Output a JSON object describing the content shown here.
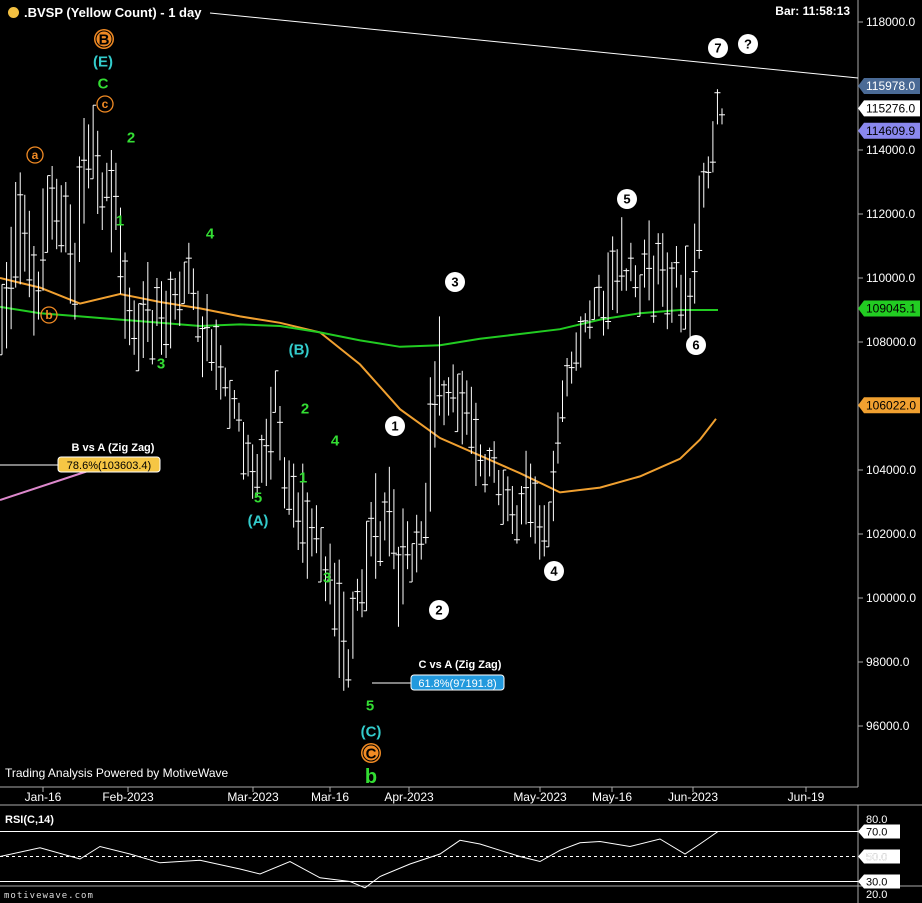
{
  "header": {
    "title": ".BVSP (Yellow Count) - 1 day",
    "bar_time": "Bar: 11:58:13"
  },
  "colors": {
    "background": "#000000",
    "price_bars": "#ffffff",
    "ma_fast": "#f0a030",
    "ma_slow": "#22cc22",
    "wave_green": "#33dd33",
    "wave_orange": "#f08a24",
    "wave_teal": "#33cccc",
    "trendline": "#ffffff",
    "pink_line": "#dd88cc",
    "tag_current": "#7777ee",
    "tag_high": "#3a5a8a"
  },
  "watermark": "Trading Analysis Powered by MotiveWave",
  "footer_brand": "motivewave.com",
  "chart_data": {
    "type": "line",
    "series_kind": "ohlc-bars",
    "ylim": [
      94800,
      118800
    ],
    "y_ticks": [
      "118000.0",
      "116000.0",
      "114000.0",
      "112000.0",
      "110000.0",
      "108000.0",
      "106000.0",
      "104000.0",
      "102000.0",
      "100000.0",
      "98000.0",
      "96000.0"
    ],
    "x_tick_labels": [
      "Jan-16",
      "Feb-2023",
      "Mar-2023",
      "Mar-16",
      "Apr-2023",
      "May-2023",
      "May-16",
      "Jun-2023",
      "Jun-19"
    ],
    "price_tags": [
      {
        "label": "115978.0",
        "value": 116000,
        "style": "high"
      },
      {
        "label": "115276.0",
        "value": 115300,
        "style": "last"
      },
      {
        "label": "114609.9",
        "value": 114600,
        "style": "current"
      },
      {
        "label": "109045.1",
        "value": 109045,
        "style": "ma_slow"
      },
      {
        "label": "106022.0",
        "value": 106022,
        "style": "ma_fast"
      }
    ],
    "bars": [
      [
        107600,
        109800
      ],
      [
        107800,
        110500
      ],
      [
        108400,
        111600
      ],
      [
        109700,
        113000
      ],
      [
        109800,
        113300
      ],
      [
        110200,
        112600
      ],
      [
        109400,
        112100
      ],
      [
        108200,
        111000
      ],
      [
        108700,
        110200
      ],
      [
        109600,
        112800
      ],
      [
        110800,
        113200
      ],
      [
        111200,
        113500
      ],
      [
        110900,
        113100
      ],
      [
        110800,
        112900
      ],
      [
        110800,
        113000
      ],
      [
        109200,
        112300
      ],
      [
        108700,
        111100
      ],
      [
        110500,
        113800
      ],
      [
        111700,
        115000
      ],
      [
        112800,
        114800
      ],
      [
        113100,
        115400
      ],
      [
        112000,
        114600
      ],
      [
        111500,
        113300
      ],
      [
        112400,
        113600
      ],
      [
        110800,
        114000
      ],
      [
        111500,
        113600
      ],
      [
        109500,
        112200
      ],
      [
        108100,
        110800
      ],
      [
        107900,
        109700
      ],
      [
        107600,
        109300
      ],
      [
        107100,
        109200
      ],
      [
        107500,
        109900
      ],
      [
        108000,
        110500
      ],
      [
        107300,
        109000
      ],
      [
        108500,
        110000
      ],
      [
        107600,
        109900
      ],
      [
        107500,
        109600
      ],
      [
        107800,
        110200
      ],
      [
        108700,
        110000
      ],
      [
        108500,
        110200
      ],
      [
        109200,
        110500
      ],
      [
        109500,
        111100
      ],
      [
        109000,
        110300
      ],
      [
        108000,
        109600
      ],
      [
        106900,
        108800
      ],
      [
        107400,
        109500
      ],
      [
        107100,
        108400
      ],
      [
        106500,
        108700
      ],
      [
        106200,
        107900
      ],
      [
        106300,
        107200
      ],
      [
        105300,
        106800
      ],
      [
        105600,
        106500
      ],
      [
        105200,
        106100
      ],
      [
        103700,
        105500
      ],
      [
        103800,
        105100
      ],
      [
        103100,
        104800
      ],
      [
        103200,
        104500
      ],
      [
        103600,
        105100
      ],
      [
        103500,
        105600
      ],
      [
        103700,
        106600
      ],
      [
        105800,
        107100
      ],
      [
        104300,
        106000
      ],
      [
        102800,
        104400
      ],
      [
        102600,
        104300
      ],
      [
        102200,
        104200
      ],
      [
        101500,
        103300
      ],
      [
        101100,
        104200
      ],
      [
        100600,
        103300
      ],
      [
        101300,
        102800
      ],
      [
        101400,
        102900
      ],
      [
        100500,
        102200
      ],
      [
        99900,
        101300
      ],
      [
        99800,
        101700
      ],
      [
        98800,
        101100
      ],
      [
        97500,
        101200
      ],
      [
        97100,
        100200
      ],
      [
        97200,
        98400
      ],
      [
        98100,
        100200
      ],
      [
        99600,
        100600
      ],
      [
        99400,
        100900
      ],
      [
        99600,
        102400
      ],
      [
        101300,
        103000
      ],
      [
        100600,
        103900
      ],
      [
        101000,
        102400
      ],
      [
        101800,
        103300
      ],
      [
        101300,
        104100
      ],
      [
        100900,
        103400
      ],
      [
        99100,
        101600
      ],
      [
        99800,
        102800
      ],
      [
        100900,
        102400
      ],
      [
        100500,
        101700
      ],
      [
        100800,
        102600
      ],
      [
        101200,
        102400
      ],
      [
        101700,
        103600
      ],
      [
        102700,
        106900
      ],
      [
        104700,
        107400
      ],
      [
        105700,
        108800
      ],
      [
        105400,
        106800
      ],
      [
        105700,
        106900
      ],
      [
        105800,
        107300
      ],
      [
        105200,
        107000
      ],
      [
        104800,
        107100
      ],
      [
        105100,
        106800
      ],
      [
        104500,
        106600
      ],
      [
        103500,
        106100
      ],
      [
        103800,
        104800
      ],
      [
        103300,
        104500
      ],
      [
        103800,
        104700
      ],
      [
        103600,
        104900
      ],
      [
        102900,
        104000
      ],
      [
        102300,
        104000
      ],
      [
        102400,
        103800
      ],
      [
        102000,
        103500
      ],
      [
        101700,
        102900
      ],
      [
        102300,
        103500
      ],
      [
        102300,
        104600
      ],
      [
        101900,
        104200
      ],
      [
        101700,
        103800
      ],
      [
        101200,
        102900
      ],
      [
        101300,
        102900
      ],
      [
        101600,
        103000
      ],
      [
        102400,
        104600
      ],
      [
        104200,
        105800
      ],
      [
        105500,
        106800
      ],
      [
        106300,
        107500
      ],
      [
        106700,
        107700
      ],
      [
        107100,
        108300
      ],
      [
        107200,
        108800
      ],
      [
        108300,
        108900
      ],
      [
        108100,
        109300
      ],
      [
        108700,
        109700
      ],
      [
        108800,
        110100
      ],
      [
        108200,
        109600
      ],
      [
        108400,
        110800
      ],
      [
        109000,
        111300
      ],
      [
        108900,
        110900
      ],
      [
        109600,
        111900
      ],
      [
        109600,
        110300
      ],
      [
        109900,
        111100
      ],
      [
        109400,
        110400
      ],
      [
        108800,
        110100
      ],
      [
        109700,
        111200
      ],
      [
        109300,
        111800
      ],
      [
        108600,
        110700
      ],
      [
        109800,
        111400
      ],
      [
        109100,
        111400
      ],
      [
        108400,
        110800
      ],
      [
        108600,
        110500
      ],
      [
        109700,
        111000
      ],
      [
        108300,
        110100
      ],
      [
        108400,
        111000
      ],
      [
        108100,
        110000
      ],
      [
        109200,
        111700
      ],
      [
        110600,
        113200
      ],
      [
        112200,
        113600
      ],
      [
        112800,
        113800
      ],
      [
        113300,
        114900
      ],
      [
        114800,
        115900
      ],
      [
        114800,
        115300
      ]
    ],
    "ma_fast": [
      [
        0,
        110000
      ],
      [
        40,
        109700
      ],
      [
        80,
        109200
      ],
      [
        120,
        109500
      ],
      [
        160,
        109250
      ],
      [
        200,
        109050
      ],
      [
        240,
        108800
      ],
      [
        280,
        108600
      ],
      [
        320,
        108300
      ],
      [
        360,
        107300
      ],
      [
        400,
        105900
      ],
      [
        440,
        105000
      ],
      [
        480,
        104450
      ],
      [
        520,
        103900
      ],
      [
        560,
        103300
      ],
      [
        600,
        103450
      ],
      [
        640,
        103800
      ],
      [
        680,
        104350
      ],
      [
        700,
        104950
      ],
      [
        716,
        105600
      ]
    ],
    "ma_slow": [
      [
        0,
        109100
      ],
      [
        40,
        108900
      ],
      [
        80,
        108800
      ],
      [
        120,
        108700
      ],
      [
        160,
        108600
      ],
      [
        200,
        108500
      ],
      [
        240,
        108550
      ],
      [
        280,
        108500
      ],
      [
        320,
        108300
      ],
      [
        360,
        108050
      ],
      [
        400,
        107850
      ],
      [
        440,
        107900
      ],
      [
        480,
        108100
      ],
      [
        520,
        108250
      ],
      [
        560,
        108400
      ],
      [
        600,
        108700
      ],
      [
        640,
        108900
      ],
      [
        680,
        109000
      ],
      [
        718,
        109000
      ]
    ],
    "trendlines": [
      {
        "name": "upper-trendline",
        "from": [
          210,
          118800
        ],
        "to": [
          860,
          116100
        ]
      },
      {
        "name": "pink-trendline",
        "from": [
          0,
          102600
        ],
        "to": [
          90,
          103500
        ]
      }
    ],
    "fib_labels": [
      {
        "title": "B vs A (Zig Zag)",
        "tag": "78.6%(103603.4)",
        "value": 103603,
        "style": "yellow"
      },
      {
        "title": "C vs A (Zig Zag)",
        "tag": "61.8%(97191.8)",
        "value": 97192,
        "style": "blue"
      }
    ],
    "wave_labels": [
      {
        "text": "B",
        "style": "orange-circle"
      },
      {
        "text": "(E)",
        "style": "teal"
      },
      {
        "text": "C",
        "style": "green"
      },
      {
        "text": "c",
        "style": "orange-ring"
      },
      {
        "text": "2",
        "style": "green"
      },
      {
        "text": "a",
        "style": "orange-ring"
      },
      {
        "text": "1",
        "style": "green"
      },
      {
        "text": "b",
        "style": "orange-ring"
      },
      {
        "text": "4",
        "style": "green"
      },
      {
        "text": "3",
        "style": "green"
      },
      {
        "text": "(B)",
        "style": "teal"
      },
      {
        "text": "2",
        "style": "green"
      },
      {
        "text": "4",
        "style": "green"
      },
      {
        "text": "1",
        "style": "green"
      },
      {
        "text": "5",
        "style": "green"
      },
      {
        "text": "(A)",
        "style": "teal"
      },
      {
        "text": "3",
        "style": "green"
      },
      {
        "text": "5",
        "style": "green"
      },
      {
        "text": "(C)",
        "style": "teal"
      },
      {
        "text": "C",
        "style": "orange-circle"
      },
      {
        "text": "b",
        "style": "green-big"
      },
      {
        "text": "1",
        "style": "white-circle"
      },
      {
        "text": "2",
        "style": "white-circle"
      },
      {
        "text": "3",
        "style": "white-circle"
      },
      {
        "text": "4",
        "style": "white-circle"
      },
      {
        "text": "5",
        "style": "white-circle"
      },
      {
        "text": "6",
        "style": "white-circle"
      },
      {
        "text": "7",
        "style": "white-circle"
      },
      {
        "text": "?",
        "style": "white-circle"
      }
    ]
  },
  "rsi": {
    "label": "RSI(C,14)",
    "ylim": [
      15,
      85
    ],
    "y_ticks": [
      "80.0",
      "50.0",
      "20.0"
    ],
    "levels": [
      {
        "label": "70.0",
        "value": 70
      },
      {
        "label": "50.0",
        "value": 50
      },
      {
        "label": "30.0",
        "value": 30
      }
    ],
    "values": [
      [
        0,
        50
      ],
      [
        40,
        57
      ],
      [
        80,
        48
      ],
      [
        100,
        58
      ],
      [
        130,
        52
      ],
      [
        160,
        45
      ],
      [
        200,
        47
      ],
      [
        240,
        40
      ],
      [
        260,
        36
      ],
      [
        290,
        46
      ],
      [
        320,
        33
      ],
      [
        350,
        30
      ],
      [
        365,
        25
      ],
      [
        380,
        34
      ],
      [
        410,
        44
      ],
      [
        440,
        52
      ],
      [
        460,
        63
      ],
      [
        480,
        60
      ],
      [
        500,
        55
      ],
      [
        520,
        50
      ],
      [
        540,
        46
      ],
      [
        560,
        55
      ],
      [
        580,
        61
      ],
      [
        600,
        62
      ],
      [
        630,
        58
      ],
      [
        660,
        64
      ],
      [
        685,
        52
      ],
      [
        700,
        60
      ],
      [
        718,
        70
      ]
    ]
  }
}
